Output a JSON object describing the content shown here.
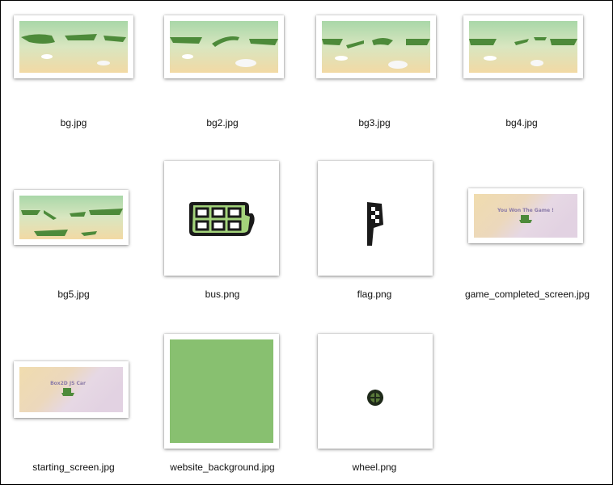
{
  "files": [
    {
      "name": "bg.jpg",
      "kind": "bg-landscape"
    },
    {
      "name": "bg2.jpg",
      "kind": "bg-landscape"
    },
    {
      "name": "bg3.jpg",
      "kind": "bg-landscape"
    },
    {
      "name": "bg4.jpg",
      "kind": "bg-landscape"
    },
    {
      "name": "bg5.jpg",
      "kind": "bg-landscape"
    },
    {
      "name": "bus.png",
      "kind": "bus-sprite"
    },
    {
      "name": "flag.png",
      "kind": "flag-sprite"
    },
    {
      "name": "game_completed_screen.jpg",
      "kind": "game-completed-screen",
      "caption": "You Won The Game !"
    },
    {
      "name": "starting_screen.jpg",
      "kind": "starting-screen",
      "caption": "Box2D JS Car"
    },
    {
      "name": "website_background.jpg",
      "kind": "green-background"
    },
    {
      "name": "wheel.png",
      "kind": "wheel-sprite"
    }
  ],
  "colors": {
    "sky": "#b6dcb0",
    "sand": "#f0dcaa",
    "grass": "#4c8a3a",
    "website_green": "#88c070",
    "thumb_border": "#ffffff"
  }
}
